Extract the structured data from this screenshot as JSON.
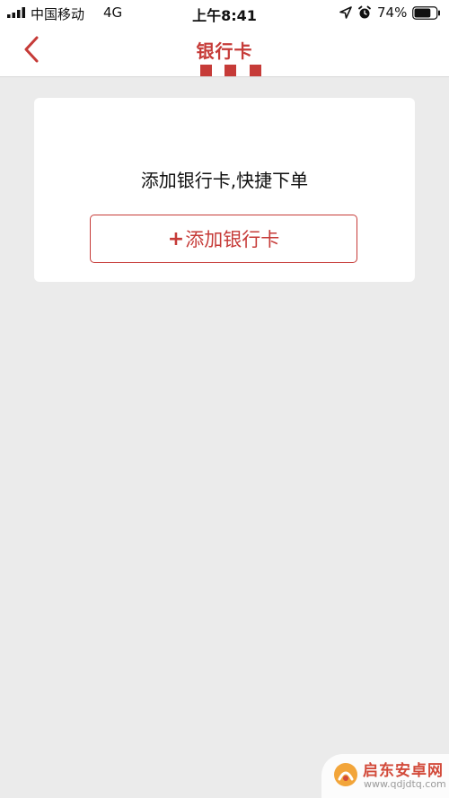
{
  "status_bar": {
    "carrier": "中国移动",
    "network": "4G",
    "time": "上午8:41",
    "battery_percent": "74%",
    "battery_level": 0.74
  },
  "nav": {
    "back_icon": "chevron-left-icon",
    "title": "银行卡"
  },
  "card": {
    "message": "添加银行卡,快捷下单",
    "add_button": {
      "plus": "+",
      "label": "添加银行卡"
    }
  },
  "watermark": {
    "name": "启东安卓网",
    "url": "www.qdjdtq.com"
  },
  "colors": {
    "accent": "#c63b38",
    "background": "#ebebeb",
    "card": "#ffffff"
  }
}
